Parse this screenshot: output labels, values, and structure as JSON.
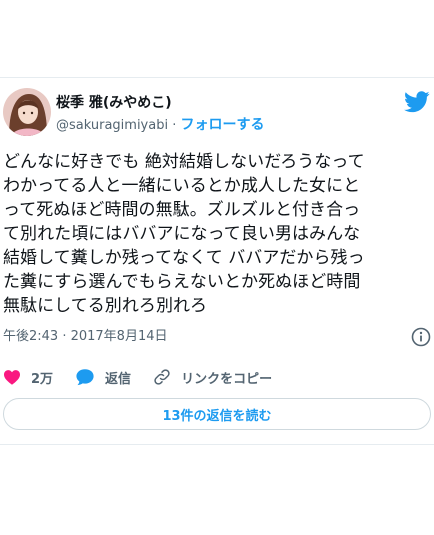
{
  "tweet": {
    "author": {
      "display_name": "桜季 雅(みやめこ)",
      "handle": "@sakuragimiyabi",
      "separator": "·",
      "follow_label": "フォローする",
      "avatar_icon": "avatar-photo"
    },
    "brand_icon": "twitter-bird-icon",
    "text_lines": [
      "どんなに好きでも 絶対結婚しないだろうなって",
      "わかってる人と一緒にいるとか成人した女にと",
      "って死ぬほど時間の無駄。ズルズルと付き合っ",
      "て別れた頃にはババアになって良い男はみんな",
      "結婚して糞しか残ってなくて ババアだから残っ",
      "た糞にすら選んでもらえないとか死ぬほど時間",
      "無駄にしてる別れろ別れろ"
    ],
    "timestamp": "午後2:43 · 2017年8月14日",
    "info_icon": "info-icon",
    "actions": {
      "like_count": "2万",
      "reply_label": "返信",
      "copy_link_label": "リンクをコピー"
    },
    "replies_button_label": "13件の返信を読む"
  },
  "colors": {
    "accent": "#1d9bf0",
    "like": "#f91880",
    "muted_text": "#536471",
    "border": "#cfd9de"
  }
}
